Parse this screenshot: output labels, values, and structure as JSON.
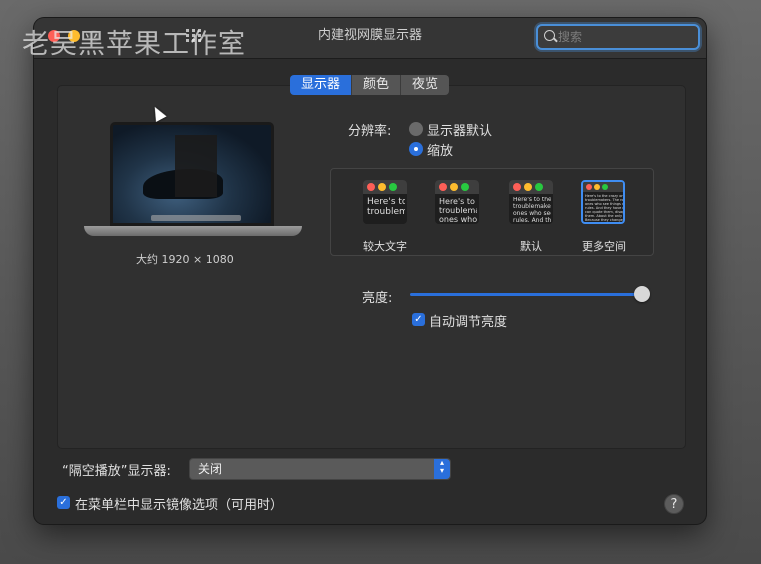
{
  "watermark": "老吴黑苹果工作室",
  "window": {
    "title": "内建视网膜显示器",
    "search_placeholder": "搜索"
  },
  "tabs": [
    {
      "label": "显示器",
      "active": true
    },
    {
      "label": "颜色",
      "active": false
    },
    {
      "label": "夜览",
      "active": false
    }
  ],
  "display": {
    "resolution_caption": "大约 1920 × 1080",
    "resolution_label": "分辨率:",
    "options": [
      {
        "label": "显示器默认",
        "selected": false
      },
      {
        "label": "缩放",
        "selected": true
      }
    ],
    "scaling": [
      {
        "preview": "Here's to\ntroublem",
        "label": "较大文字",
        "selected": false
      },
      {
        "preview": "Here's to t\ntroublema\nones who",
        "label": "",
        "selected": false
      },
      {
        "preview": "Here's to the\ntroublemakers.\nones who see t\nrules. And they",
        "label": "默认",
        "selected": false
      },
      {
        "preview": "Here's to the crazy ones\ntroublemakers. The rou\nones who see things di\nrules. And they have no\ncan quote them, disagr\nthem. About the only th\nBecause they change t",
        "label": "更多空间",
        "selected": true
      }
    ],
    "brightness_label": "亮度:",
    "brightness_level": 1.0,
    "auto_brightness_label": "自动调节亮度",
    "auto_brightness_checked": true
  },
  "airplay": {
    "label": "“隔空播放”显示器:",
    "value": "关闭"
  },
  "mirroring": {
    "label": "在菜单栏中显示镜像选项（可用时）",
    "checked": true
  },
  "colors": {
    "accent": "#2a6fdb",
    "close": "#fe5f57",
    "minimize": "#febc2e"
  }
}
